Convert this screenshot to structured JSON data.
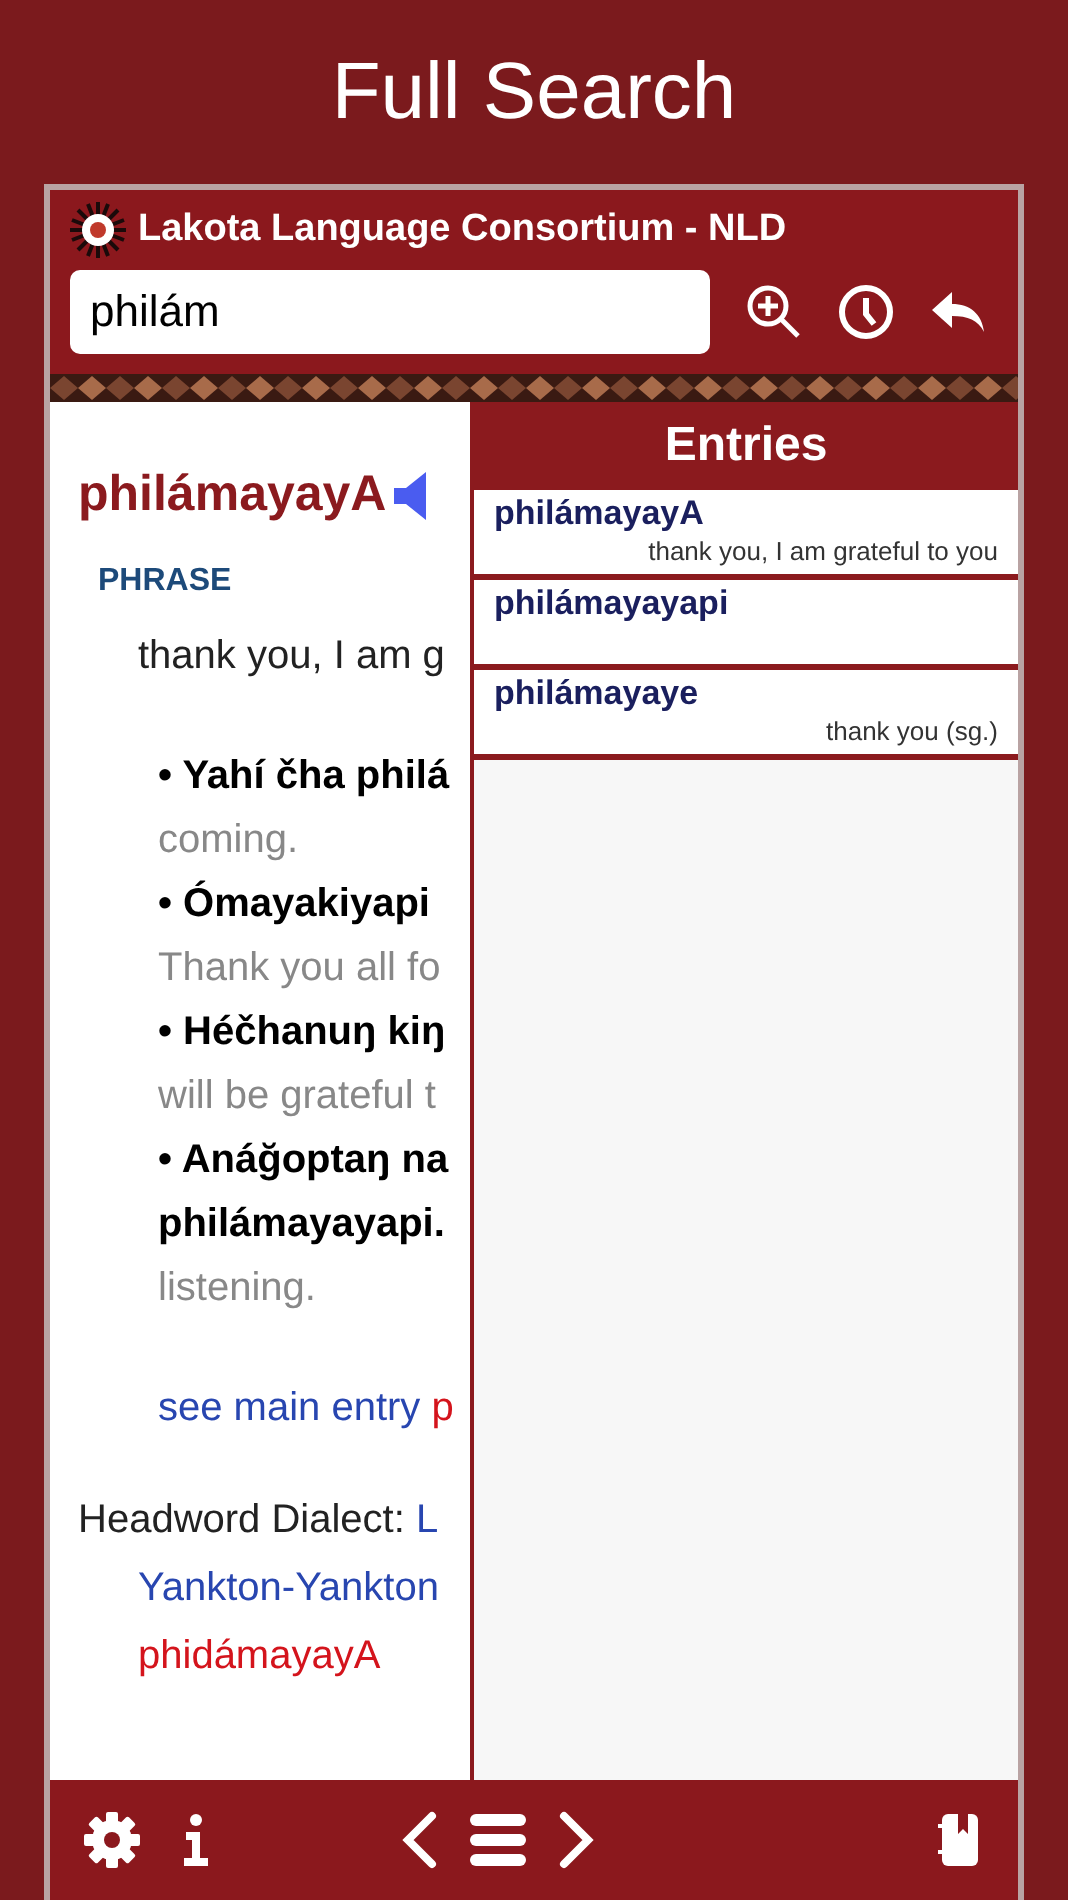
{
  "page_title": "Full Search",
  "window": {
    "title": "Lakota Language Consortium - NLD"
  },
  "search": {
    "value": "philám"
  },
  "entry": {
    "headword": "philámayayA",
    "part_of_speech": "PHRASE",
    "definition": "thank you, I am g",
    "example_lines": [
      {
        "kind": "lakota",
        "text": "• Yahí čha philá"
      },
      {
        "kind": "english",
        "text": "coming."
      },
      {
        "kind": "lakota",
        "text": "• Ómayakiyapi"
      },
      {
        "kind": "english",
        "text": "Thank you all fo"
      },
      {
        "kind": "lakota",
        "text": "• Héčhanuŋ kiŋ"
      },
      {
        "kind": "english",
        "text": "will be grateful t"
      },
      {
        "kind": "lakota",
        "text": "• Anáğoptaŋ na"
      },
      {
        "kind": "lakota",
        "text": "philámayayapi."
      },
      {
        "kind": "english",
        "text": "listening."
      }
    ],
    "see_main_entry": {
      "label": "see main entry",
      "target": "p"
    },
    "dialect": {
      "label": "Headword Dialect:",
      "value": "L",
      "value_line_2": "Yankton-Yankton",
      "variant": "phidámayayA"
    }
  },
  "entries_panel": {
    "title": "Entries",
    "items": [
      {
        "headword": "philámayayA",
        "gloss": "thank you, I am grateful to you"
      },
      {
        "headword": "philámayayapi"
      },
      {
        "headword": "philámayaye",
        "gloss": "thank you (sg.)"
      }
    ]
  }
}
